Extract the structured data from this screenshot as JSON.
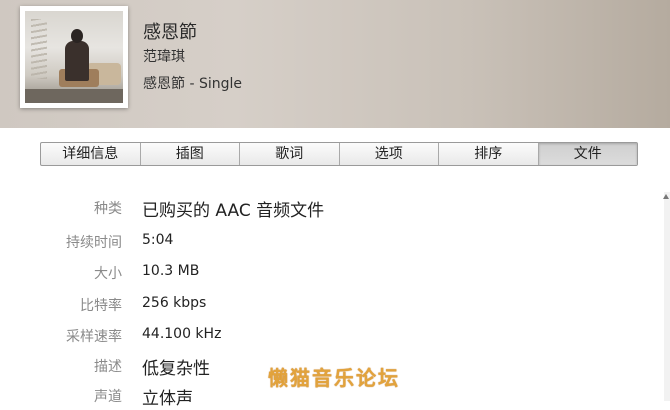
{
  "song": {
    "title": "感恩節",
    "artist": "范瑋琪",
    "album": "感恩節 - Single"
  },
  "tabs": [
    {
      "label": "详细信息",
      "active": false
    },
    {
      "label": "插图",
      "active": false
    },
    {
      "label": "歌词",
      "active": false
    },
    {
      "label": "选项",
      "active": false
    },
    {
      "label": "排序",
      "active": false
    },
    {
      "label": "文件",
      "active": true
    }
  ],
  "details": [
    {
      "label": "种类",
      "value": "已购买的 AAC 音频文件"
    },
    {
      "label": "持续时间",
      "value": "5:04"
    },
    {
      "label": "大小",
      "value": "10.3 MB"
    },
    {
      "label": "比特率",
      "value": "256 kbps"
    },
    {
      "label": "采样速率",
      "value": "44.100 kHz"
    },
    {
      "label": "描述",
      "value": "低复杂性"
    },
    {
      "label": "声道",
      "value": "立体声"
    }
  ],
  "watermark": "懒猫音乐论坛",
  "colors": {
    "label_gray": "#8a8a8a",
    "watermark_orange": "#e2a33c"
  }
}
